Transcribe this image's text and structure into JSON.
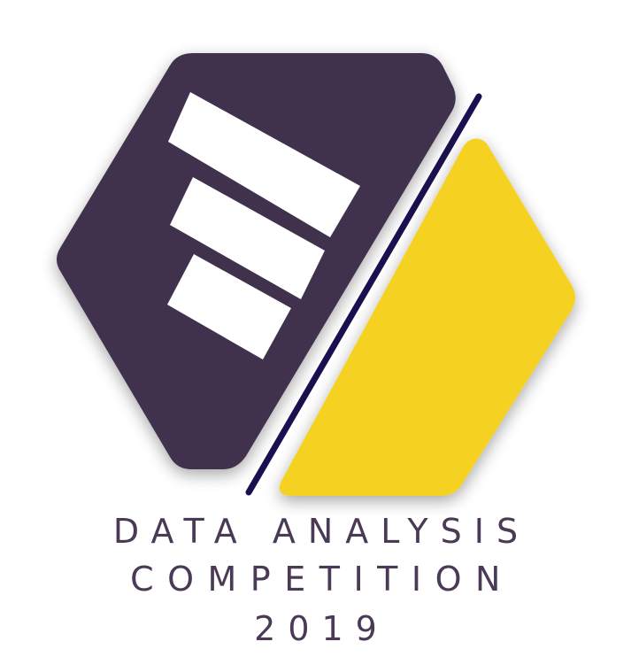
{
  "logo": {
    "colors": {
      "dark_panel": "#41304d",
      "yellow_panel": "#f5d224",
      "divider_line": "#1c0f4f",
      "bars": "#ffffff",
      "text": "#4a3a56"
    }
  },
  "caption": {
    "line1": "DATA ANALYSIS",
    "line2": "COMPETITION",
    "line3": "2019"
  }
}
